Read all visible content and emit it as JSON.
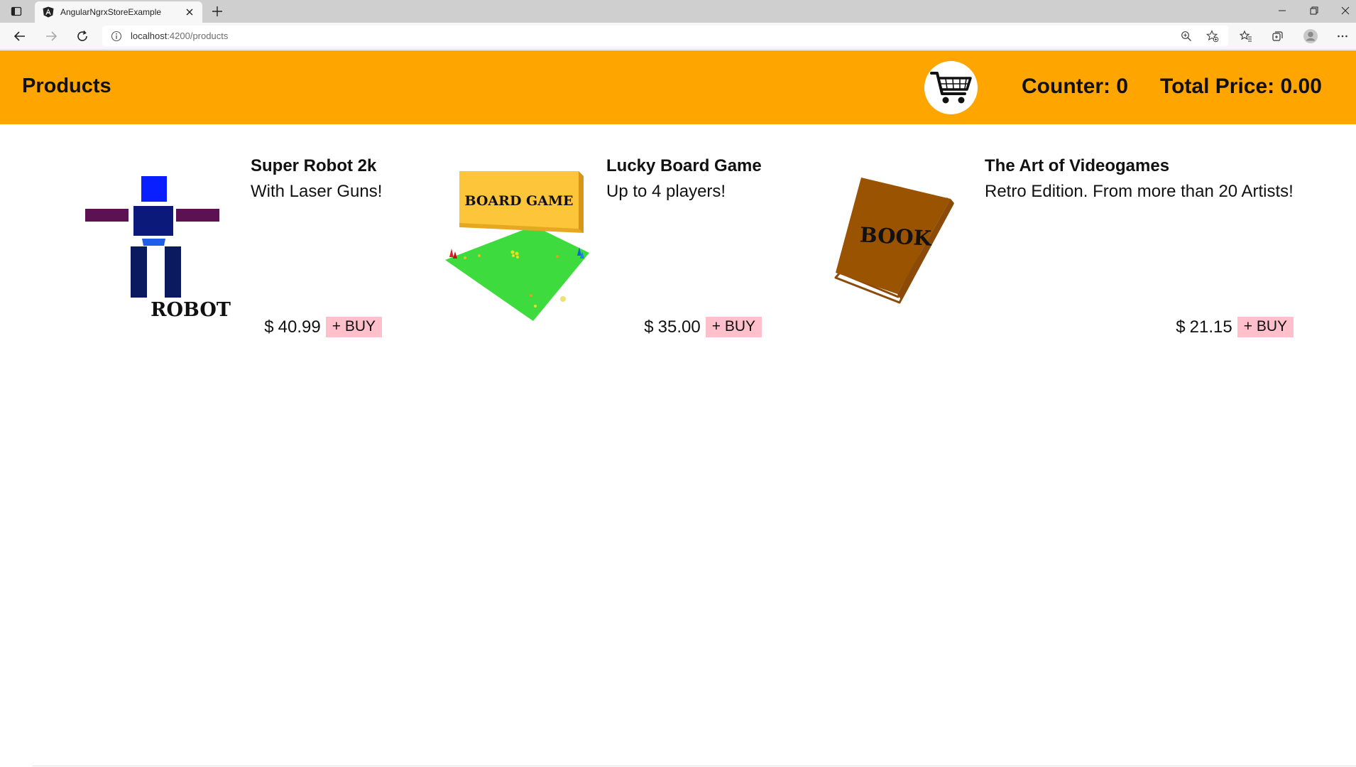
{
  "browser": {
    "tab_title": "AngularNgrxStoreExample",
    "url_host": "localhost",
    "url_rest": ":4200/products"
  },
  "header": {
    "title": "Products",
    "counter_label": "Counter:",
    "counter_value": "0",
    "total_label": "Total Price:",
    "total_value": "0.00",
    "accent_color": "#ffa500"
  },
  "products": [
    {
      "name": "Super Robot 2k",
      "description": "With Laser Guns!",
      "currency": "$",
      "price": "40.99",
      "buy_label": "+ BUY",
      "image_label": "ROBOT"
    },
    {
      "name": "Lucky Board Game",
      "description": "Up to 4 players!",
      "currency": "$",
      "price": "35.00",
      "buy_label": "+ BUY",
      "image_label": "BOARD GAME"
    },
    {
      "name": "The Art of Videogames",
      "description": "Retro Edition. From more than 20 Artists!",
      "currency": "$",
      "price": "21.15",
      "buy_label": "+ BUY",
      "image_label": "BOOK"
    }
  ],
  "colors": {
    "buy_button": "#ffc0cb",
    "header_background": "#ffa500"
  }
}
